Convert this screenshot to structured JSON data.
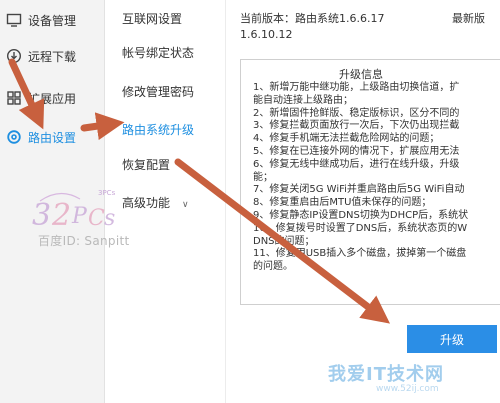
{
  "nav": {
    "items": [
      {
        "label": "设备管理",
        "icon": "monitor-icon"
      },
      {
        "label": "远程下载",
        "icon": "download-icon"
      },
      {
        "label": "扩展应用",
        "icon": "grid-icon"
      },
      {
        "label": "路由设置",
        "icon": "gear-icon",
        "active": true
      }
    ]
  },
  "submenu": {
    "items": [
      {
        "label": "互联网设置"
      },
      {
        "label": "帐号绑定状态"
      },
      {
        "label": "修改管理密码"
      },
      {
        "label": "路由系统升级",
        "active": true
      },
      {
        "label": "恢复配置"
      },
      {
        "label": "高级功能"
      }
    ]
  },
  "version": {
    "current_label": "当前版本：路由系统1.6.6.17",
    "latest_label": "最新版",
    "latest_value": "1.6.10.12"
  },
  "info": {
    "title": "升级信息",
    "lines": [
      "1、新增万能中继功能，上级路由切换信道，扩",
      "能自动连接上级路由；",
      "2、新增固件抢鲜版、稳定版标识，区分不同的",
      "3、修复拦截页面放行一次后，下次仍出现拦截",
      "4、修复手机端无法拦截危险网站的问题；",
      "5、修复在已连接外网的情况下，扩展应用无法",
      "6、修复无线中继成功后，进行在线升级，升级",
      "能；",
      "7、修复关闭5G WiFi并重启路由后5G WiFi自动",
      "8、修复重启由后MTU值未保存的问题；",
      "9、修复静态IP设置DNS切换为DHCP后，系统状",
      "10、修复拨号时设置了DNS后，系统状态页的W",
      "DNS的问题；",
      "11、修复用USB插入多个磁盘，拔掉第一个磁盘",
      "的问题。"
    ]
  },
  "actions": {
    "upgrade_label": "升级"
  },
  "watermark": {
    "logo_small": "3PCs",
    "baidu_id": "百度ID: Sanpitt",
    "site_name": "我爱IT技术网",
    "site_url": "www.52ij.com"
  },
  "colors": {
    "accent": "#1e8fe0",
    "button": "#2b8ee6",
    "arrow": "#c8603e"
  }
}
